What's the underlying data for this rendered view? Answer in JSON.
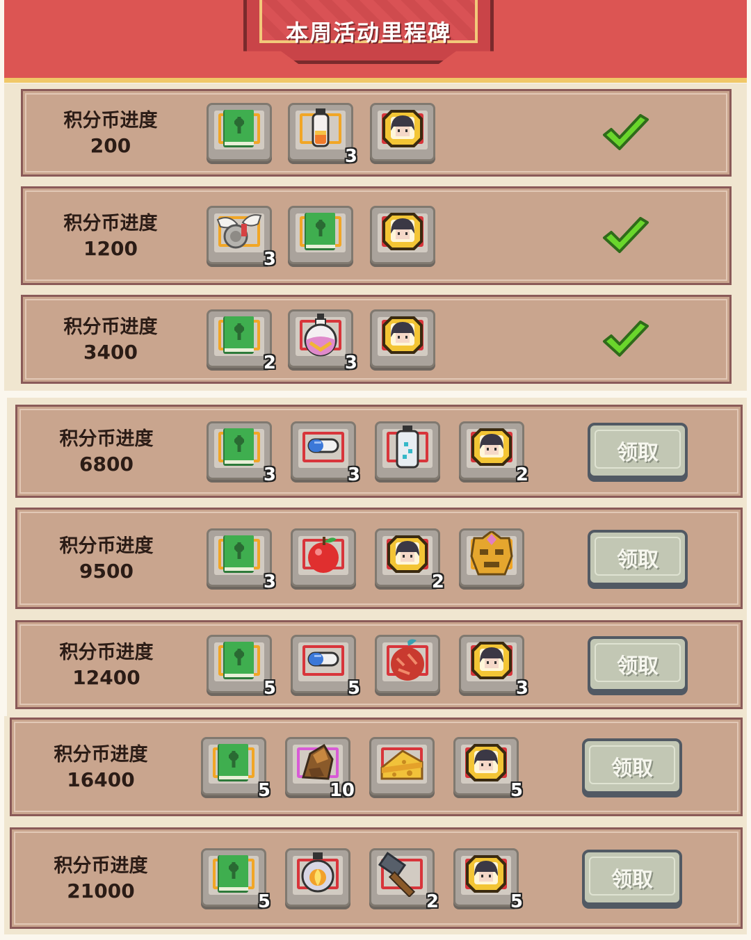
{
  "title": "本周活动里程碑",
  "progress_label": "积分币进度",
  "claim_label": "领取",
  "colors": {
    "header": "#dc5553",
    "row": "#c9a58e",
    "common_frame": "#f1a626",
    "rare_frame": "#d8353b",
    "epic_frame": "#d85bd6",
    "check": "#6ad62c"
  },
  "milestones": [
    {
      "points": "200",
      "status": "claimed",
      "rewards": [
        {
          "icon": "green-book-icon",
          "count": ""
        },
        {
          "icon": "potion-vial-icon",
          "count": "3"
        },
        {
          "icon": "hero-portrait-token-icon",
          "count": ""
        }
      ]
    },
    {
      "points": "1200",
      "status": "claimed",
      "rewards": [
        {
          "icon": "winged-scroll-icon",
          "count": "3"
        },
        {
          "icon": "green-book-icon",
          "count": ""
        },
        {
          "icon": "hero-portrait-token-icon",
          "count": ""
        }
      ]
    },
    {
      "points": "3400",
      "status": "claimed",
      "rewards": [
        {
          "icon": "green-book-icon",
          "count": "2"
        },
        {
          "icon": "pink-potion-flask-icon",
          "count": "3"
        },
        {
          "icon": "hero-portrait-token-icon",
          "count": ""
        }
      ]
    },
    {
      "points": "6800",
      "status": "claimable",
      "rewards": [
        {
          "icon": "green-book-icon",
          "count": "3"
        },
        {
          "icon": "blue-pill-capsule-icon",
          "count": "3"
        },
        {
          "icon": "gem-bottle-icon",
          "count": ""
        },
        {
          "icon": "hero-portrait-token-icon",
          "count": "2"
        }
      ]
    },
    {
      "points": "9500",
      "status": "claimable",
      "rewards": [
        {
          "icon": "green-book-icon",
          "count": "3"
        },
        {
          "icon": "red-apple-icon",
          "count": ""
        },
        {
          "icon": "hero-portrait-token-icon",
          "count": "2"
        },
        {
          "icon": "golden-mask-icon",
          "count": ""
        }
      ]
    },
    {
      "points": "12400",
      "status": "claimable",
      "rewards": [
        {
          "icon": "green-book-icon",
          "count": "5"
        },
        {
          "icon": "blue-pill-capsule-icon",
          "count": "5"
        },
        {
          "icon": "red-fruit-icon",
          "count": ""
        },
        {
          "icon": "hero-portrait-token-icon",
          "count": "3"
        }
      ]
    },
    {
      "points": "16400",
      "status": "claimable",
      "rewards": [
        {
          "icon": "green-book-icon",
          "count": "5"
        },
        {
          "icon": "ore-crystal-icon",
          "count": "10"
        },
        {
          "icon": "cheese-icon",
          "count": ""
        },
        {
          "icon": "hero-portrait-token-icon",
          "count": "5"
        }
      ]
    },
    {
      "points": "21000",
      "status": "claimable",
      "rewards": [
        {
          "icon": "green-book-icon",
          "count": "5"
        },
        {
          "icon": "fire-orb-bottle-icon",
          "count": ""
        },
        {
          "icon": "hammer-icon",
          "count": "2"
        },
        {
          "icon": "hero-portrait-token-icon",
          "count": "5"
        }
      ]
    }
  ]
}
